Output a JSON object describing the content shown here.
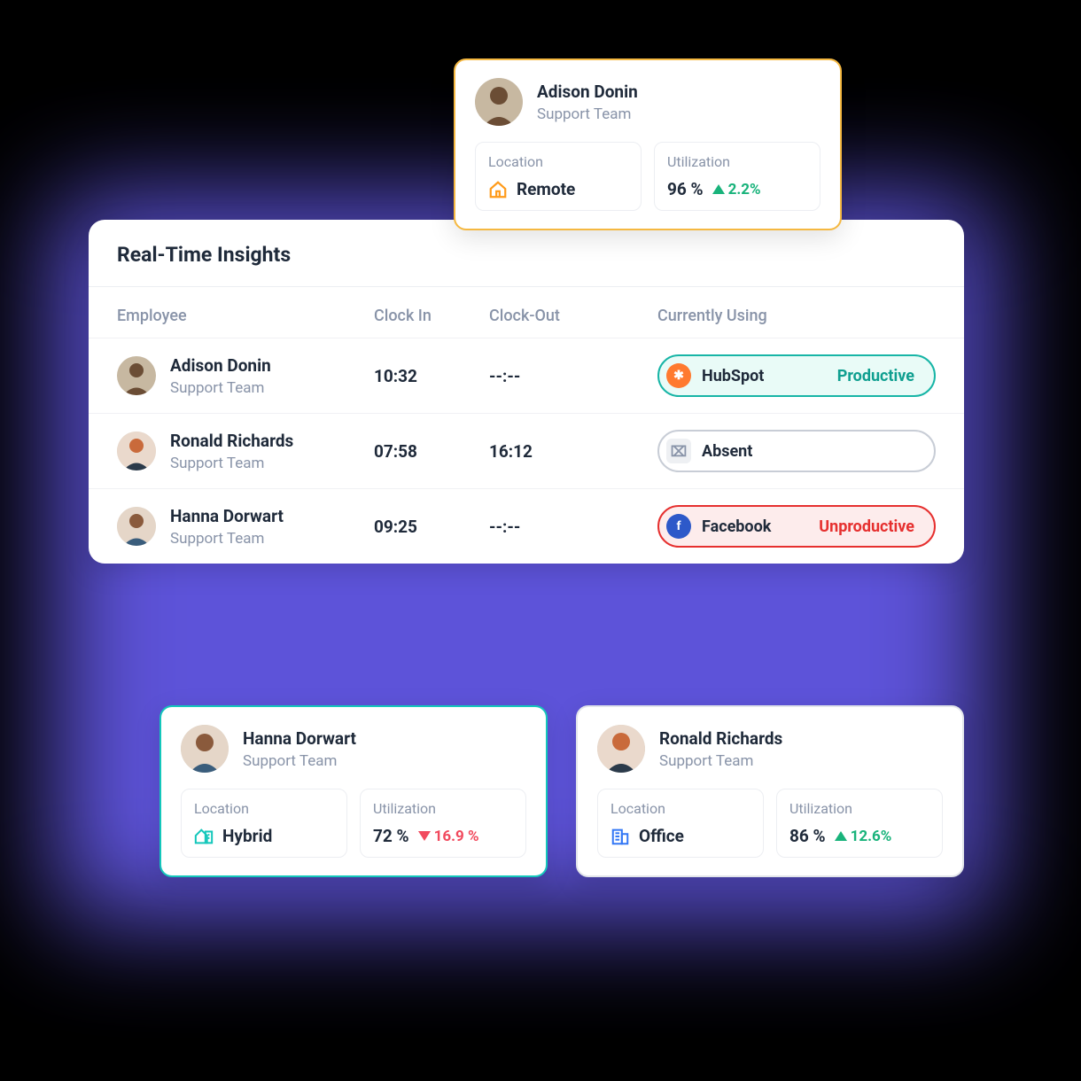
{
  "main": {
    "title": "Real-Time Insights",
    "columns": {
      "employee": "Employee",
      "clock_in": "Clock In",
      "clock_out": "Clock-Out",
      "currently_using": "Currently Using"
    },
    "rows": [
      {
        "name": "Adison Donin",
        "team": "Support Team",
        "clock_in": "10:32",
        "clock_out": "--:--",
        "app": "HubSpot",
        "status": "Productive",
        "pill_class": "pill-productive",
        "icon_bg": "#ff7a2f",
        "icon_txt": "✱"
      },
      {
        "name": "Ronald Richards",
        "team": "Support Team",
        "clock_in": "07:58",
        "clock_out": "16:12",
        "app": "Absent",
        "status": "",
        "pill_class": "pill-absent",
        "icon_bg": "#eef0f3",
        "icon_txt": "⌧"
      },
      {
        "name": "Hanna Dorwart",
        "team": "Support Team",
        "clock_in": "09:25",
        "clock_out": "--:--",
        "app": "Facebook",
        "status": "Unproductive",
        "pill_class": "pill-unproductive",
        "icon_bg": "#2d59c9",
        "icon_txt": "f"
      }
    ]
  },
  "cards": {
    "top": {
      "name": "Adison Donin",
      "team": "Support Team",
      "location_label": "Location",
      "location_value": "Remote",
      "location_icon_color": "#ff9b1a",
      "util_label": "Utilization",
      "util_value": "96 %",
      "trend_dir": "up",
      "trend_value": "2.2%"
    },
    "left": {
      "name": "Hanna Dorwart",
      "team": "Support Team",
      "location_label": "Location",
      "location_value": "Hybrid",
      "location_icon_color": "#14c7bb",
      "util_label": "Utilization",
      "util_value": "72 %",
      "trend_dir": "down",
      "trend_value": "16.9 %"
    },
    "right": {
      "name": "Ronald Richards",
      "team": "Support Team",
      "location_label": "Location",
      "location_value": "Office",
      "location_icon_color": "#3478f5",
      "util_label": "Utilization",
      "util_value": "86 %",
      "trend_dir": "up",
      "trend_value": "12.6%"
    }
  }
}
